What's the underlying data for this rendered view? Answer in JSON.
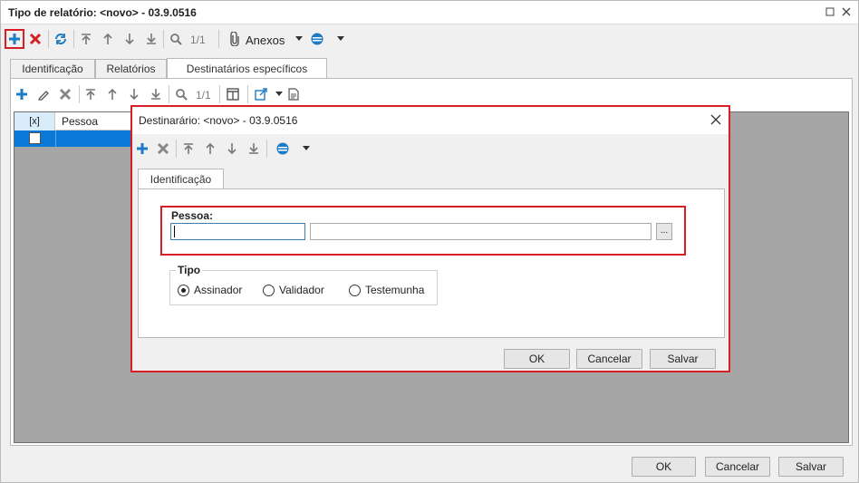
{
  "window": {
    "title": "Tipo de relatório: <novo> - 03.9.0516"
  },
  "main_toolbar": {
    "record_counter": "1/1",
    "attachments_label": "Anexos"
  },
  "main_tabs": [
    {
      "label": "Identificação"
    },
    {
      "label": "Relatórios"
    },
    {
      "label": "Destinatários específicos"
    }
  ],
  "sub_toolbar": {
    "record_counter": "1/1"
  },
  "grid": {
    "columns": [
      "[x]",
      "Pessoa"
    ]
  },
  "dialog": {
    "title": "Destinarário: <novo> - 03.9.0516",
    "tabs": [
      {
        "label": "Identificação"
      }
    ],
    "person_label": "Pessoa:",
    "person_code_value": "",
    "person_name_value": "",
    "lookup_label": "...",
    "type_label": "Tipo",
    "type_options": [
      {
        "label": "Assinador",
        "selected": true
      },
      {
        "label": "Validador",
        "selected": false
      },
      {
        "label": "Testemunha",
        "selected": false
      }
    ],
    "buttons": {
      "ok": "OK",
      "cancel": "Cancelar",
      "save": "Salvar"
    }
  },
  "footer_buttons": {
    "ok": "OK",
    "cancel": "Cancelar",
    "save": "Salvar"
  },
  "colors": {
    "accent_blue": "#0a78d7",
    "highlight_red": "#d61f26",
    "add_blue": "#1c7bc4",
    "delete_red": "#d32020",
    "grid_gray": "#a6a6a6"
  }
}
